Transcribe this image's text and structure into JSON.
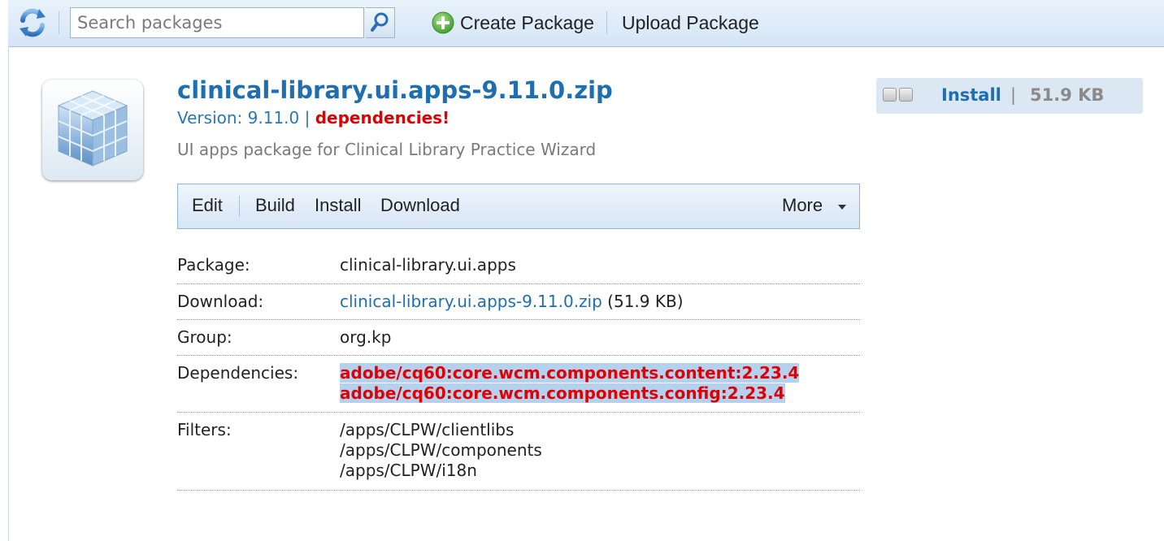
{
  "toolbar": {
    "search_placeholder": "Search packages",
    "create_label": "Create Package",
    "upload_label": "Upload Package"
  },
  "package": {
    "title": "clinical-library.ui.apps-9.11.0.zip",
    "version_text": "Version: 9.11.0",
    "version_sep": "|",
    "dependencies_warning": "dependencies!",
    "description": "UI apps package for Clinical Library Practice Wizard"
  },
  "status": {
    "action": "Install",
    "sep": "|",
    "size": "51.9 KB"
  },
  "actions": {
    "edit": "Edit",
    "build": "Build",
    "install": "Install",
    "download": "Download",
    "more": "More"
  },
  "details": {
    "package_label": "Package:",
    "package_value": "clinical-library.ui.apps",
    "download_label": "Download:",
    "download_link": "clinical-library.ui.apps-9.11.0.zip",
    "download_size": "(51.9 KB)",
    "group_label": "Group:",
    "group_value": "org.kp",
    "dependencies_label": "Dependencies:",
    "dependencies": [
      "adobe/cq60:core.wcm.components.content:2.23.4",
      "adobe/cq60:core.wcm.components.config:2.23.4"
    ],
    "filters_label": "Filters:",
    "filters": [
      "/apps/CLPW/clientlibs",
      "/apps/CLPW/components",
      "/apps/CLPW/i18n"
    ]
  },
  "icons": {
    "refresh": "refresh-icon",
    "search": "magnifier-icon",
    "create": "green-plus-icon",
    "package": "package-cube-icon"
  },
  "colors": {
    "link": "#1f6fb0",
    "warning": "#e00000",
    "selection": "#b5d1ee",
    "toolbar": "#d5e5f6"
  }
}
